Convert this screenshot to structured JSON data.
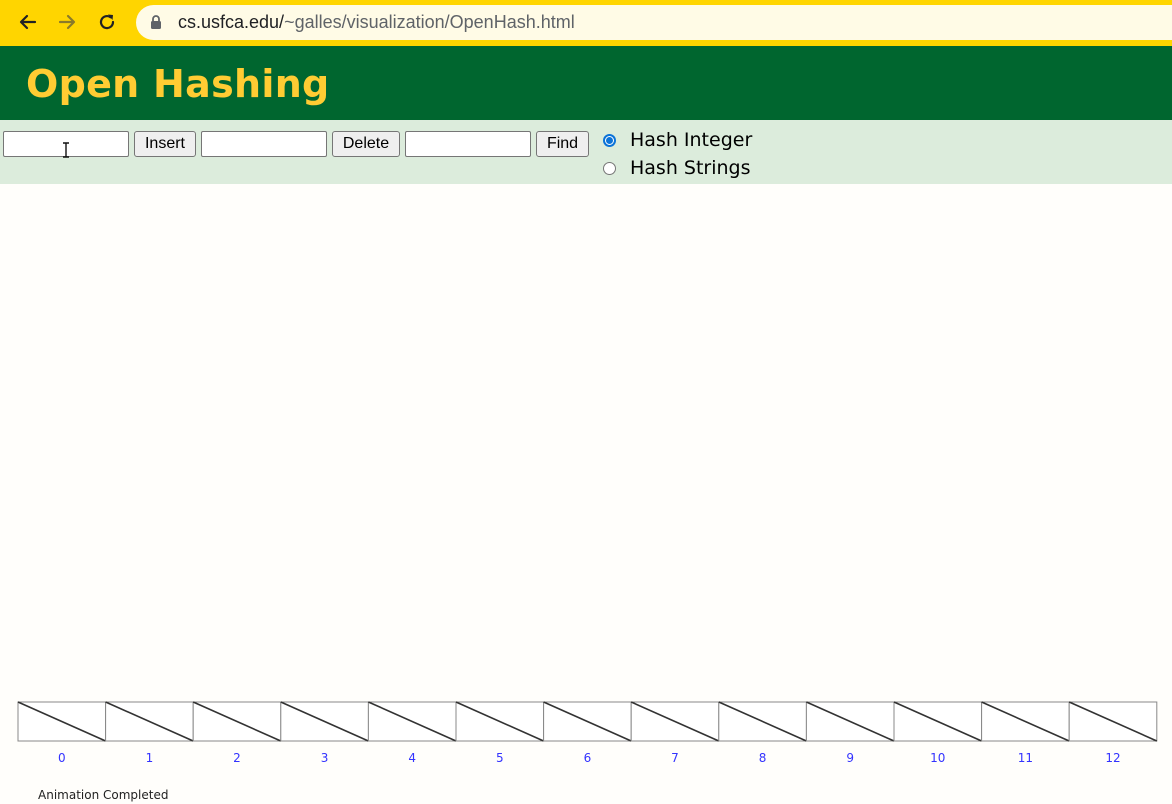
{
  "browser": {
    "url_host": "cs.usfca.edu/",
    "url_path": "~galles/visualization/OpenHash.html",
    "back_icon": "arrow-left-icon",
    "forward_icon": "arrow-right-icon",
    "reload_icon": "reload-icon",
    "lock_icon": "lock-icon"
  },
  "header": {
    "title": "Open Hashing"
  },
  "controls": {
    "insert_value": "",
    "insert_label": "Insert",
    "delete_value": "",
    "delete_label": "Delete",
    "find_value": "",
    "find_label": "Find",
    "hash_options": [
      {
        "label": "Hash Integer",
        "checked": true
      },
      {
        "label": "Hash Strings",
        "checked": false
      }
    ]
  },
  "hash_table": {
    "indices": [
      "0",
      "1",
      "2",
      "3",
      "4",
      "5",
      "6",
      "7",
      "8",
      "9",
      "10",
      "11",
      "12"
    ],
    "index_color": "#3333ff",
    "cell_border_color": "#888888",
    "null_slash_color": "#333333"
  },
  "status": {
    "message": "Animation Completed"
  },
  "colors": {
    "chrome": "#ffd500",
    "header_bg": "#00662f",
    "title": "#ffcc33",
    "controls_bg": "#dcecdc"
  }
}
